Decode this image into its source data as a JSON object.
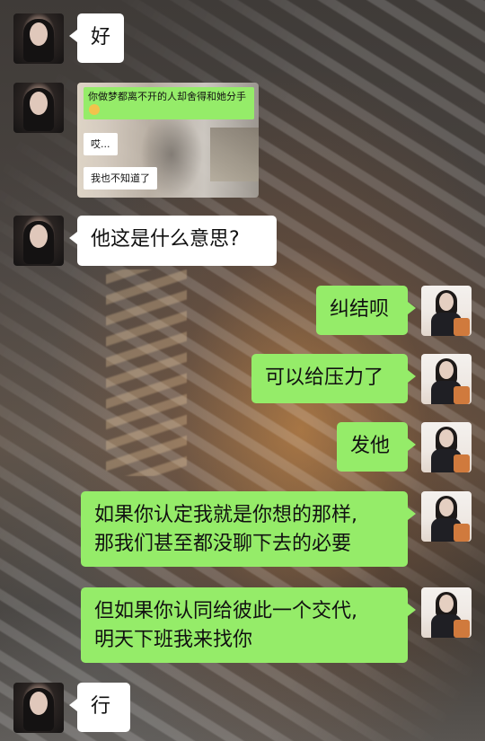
{
  "background": {
    "description_colors": {
      "base": "#4a4440",
      "glow": "#e69646"
    }
  },
  "messages": [
    {
      "id": 1,
      "side": "left",
      "type": "text",
      "text": "好"
    },
    {
      "id": 2,
      "side": "left",
      "type": "image",
      "screenshot": {
        "green_line": "你做梦都离不开的人却舍得和她分手",
        "green_emoji_icon": "smile-emoji-icon",
        "white_lines": [
          "哎...",
          "我也不知道了"
        ]
      }
    },
    {
      "id": 3,
      "side": "left",
      "type": "text",
      "text": "他这是什么意思?"
    },
    {
      "id": 4,
      "side": "right",
      "type": "text",
      "text": "纠结呗"
    },
    {
      "id": 5,
      "side": "right",
      "type": "text",
      "text": "可以给压力了"
    },
    {
      "id": 6,
      "side": "right",
      "type": "text",
      "text": "发他"
    },
    {
      "id": 7,
      "side": "right",
      "type": "text",
      "lines": [
        "如果你认定我就是你想的那样,",
        "那我们甚至都没聊下去的必要"
      ]
    },
    {
      "id": 8,
      "side": "right",
      "type": "text",
      "lines": [
        "但如果你认同给彼此一个交代,",
        "明天下班我来找你"
      ]
    },
    {
      "id": 9,
      "side": "left",
      "type": "text",
      "text": "行"
    }
  ],
  "colors": {
    "green_bubble": "#95ec69",
    "white_bubble": "#ffffff",
    "text": "#111111"
  }
}
